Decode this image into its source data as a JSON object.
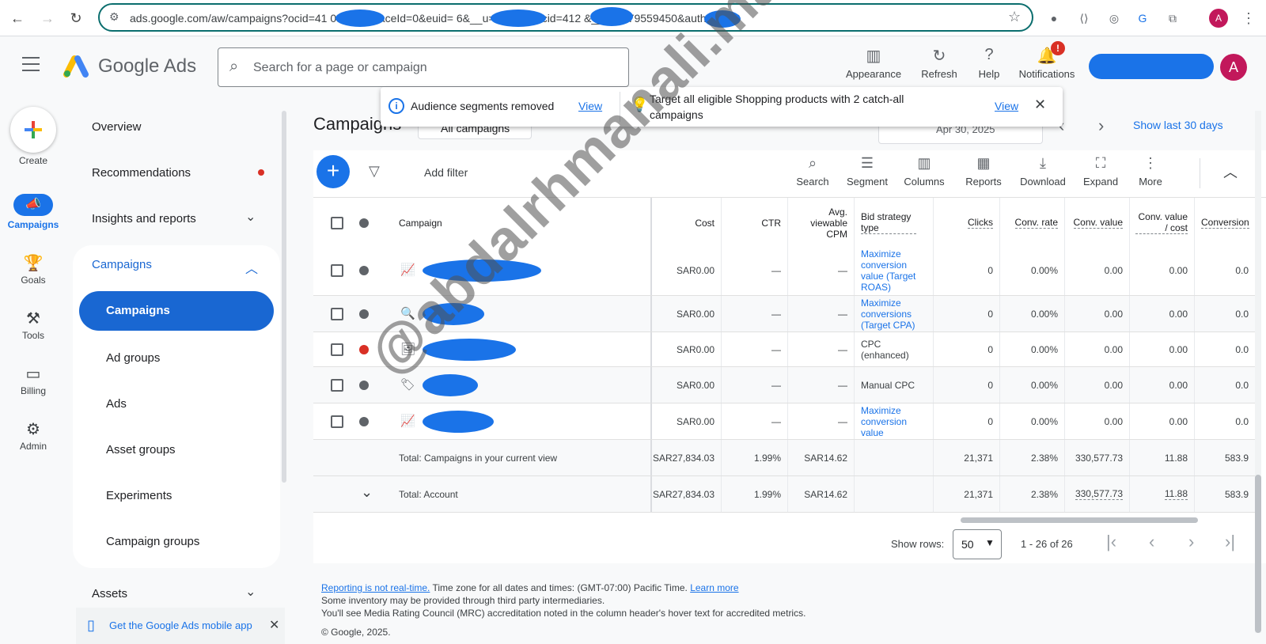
{
  "browser": {
    "url": "ads.google.com/aw/campaigns?ocid=41  0&workspaceId=0&euid=  6&__u=5  444&uscid=412  &__c=8479559450&authuser=0",
    "avatar_letter": "A"
  },
  "header": {
    "brand": "Google Ads",
    "search_placeholder": "Search for a page or campaign",
    "tools": [
      "Appearance",
      "Refresh",
      "Help",
      "Notifications"
    ],
    "notification_badge": "!",
    "avatar_letter": "A"
  },
  "rail": {
    "create": "Create",
    "items": [
      "Campaigns",
      "Goals",
      "Tools",
      "Billing",
      "Admin"
    ]
  },
  "sidenav": {
    "overview": "Overview",
    "recommendations": "Recommendations",
    "insights": "Insights and reports",
    "campaigns_group": "Campaigns",
    "sub_items": [
      "Campaigns",
      "Ad groups",
      "Ads",
      "Asset groups",
      "Experiments",
      "Campaign groups"
    ],
    "assets": "Assets",
    "mobile_app": "Get the Google Ads mobile app"
  },
  "page": {
    "title": "Campaigns",
    "all_campaigns": "All campaigns",
    "date": "Apr 30, 2025",
    "show_last": "Show last 30 days"
  },
  "toast": {
    "msg1": "Audience segments removed",
    "view1": "View",
    "msg2": "Target all eligible Shopping products with 2 catch-all campaigns",
    "view2": "View"
  },
  "toolbar": {
    "add_filter": "Add filter",
    "tools": [
      "Search",
      "Segment",
      "Columns",
      "Reports",
      "Download",
      "Expand",
      "More"
    ]
  },
  "table": {
    "headers": {
      "campaign": "Campaign",
      "cost": "Cost",
      "ctr": "CTR",
      "cpm": "Avg. viewable CPM",
      "bid": "Bid strategy type",
      "clicks": "Clicks",
      "conv_rate": "Conv. rate",
      "conv_value": "Conv. value",
      "cv_cost": "Conv. value / cost",
      "conversions": "Conversion"
    },
    "rows": [
      {
        "cost": "SAR0.00",
        "ctr": "—",
        "cpm": "—",
        "bid": "Maximize conversion value (Target ROAS)",
        "clicks": "0",
        "conv_rate": "0.00%",
        "conv_value": "0.00",
        "cv_cost": "0.00",
        "conversions": "0.0"
      },
      {
        "cost": "SAR0.00",
        "ctr": "—",
        "cpm": "—",
        "bid": "Maximize conversions (Target CPA)",
        "clicks": "0",
        "conv_rate": "0.00%",
        "conv_value": "0.00",
        "cv_cost": "0.00",
        "conversions": "0.0"
      },
      {
        "cost": "SAR0.00",
        "ctr": "—",
        "cpm": "—",
        "bid": "CPC (enhanced)",
        "clicks": "0",
        "conv_rate": "0.00%",
        "conv_value": "0.00",
        "cv_cost": "0.00",
        "conversions": "0.0"
      },
      {
        "cost": "SAR0.00",
        "ctr": "—",
        "cpm": "—",
        "bid": "Manual CPC",
        "clicks": "0",
        "conv_rate": "0.00%",
        "conv_value": "0.00",
        "cv_cost": "0.00",
        "conversions": "0.0"
      },
      {
        "cost": "SAR0.00",
        "ctr": "—",
        "cpm": "—",
        "bid": "Maximize conversion value",
        "clicks": "0",
        "conv_rate": "0.00%",
        "conv_value": "0.00",
        "cv_cost": "0.00",
        "conversions": "0.0"
      }
    ],
    "totals": [
      {
        "label": "Total: Campaigns in your current view",
        "cost": "SAR27,834.03",
        "ctr": "1.99%",
        "cpm": "SAR14.62",
        "clicks": "21,371",
        "conv_rate": "2.38%",
        "conv_value": "330,577.73",
        "cv_cost": "11.88",
        "conversions": "583.9"
      },
      {
        "label": "Total: Account",
        "cost": "SAR27,834.03",
        "ctr": "1.99%",
        "cpm": "SAR14.62",
        "clicks": "21,371",
        "conv_rate": "2.38%",
        "conv_value": "330,577.73",
        "cv_cost": "11.88",
        "conversions": "583.9"
      }
    ]
  },
  "pagination": {
    "show_rows": "Show rows:",
    "rows_value": "50",
    "range": "1 - 26 of 26"
  },
  "footer": {
    "reporting_link": "Reporting is not real-time.",
    "timezone": " Time zone for all dates and times: (GMT-07:00) Pacific Time. ",
    "learn_more": "Learn more",
    "line2": "Some inventory may be provided through third party intermediaries.",
    "line3": "You'll see Media Rating Council (MRC) accreditation noted in the column header's hover text for accredited metrics.",
    "copyright": "© Google, 2025."
  },
  "watermark": "@abdalrhmanali.marketing",
  "colors": {
    "accent": "#1a73e8",
    "active_nav": "#1967d2",
    "error": "#d93025"
  }
}
